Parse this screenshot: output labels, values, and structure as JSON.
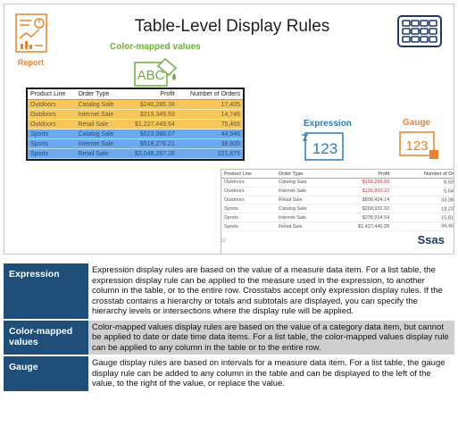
{
  "slide": {
    "title": "Table-Level Display Rules",
    "report_label": "Report",
    "color_mapped_label": "Color-mapped values",
    "abc_text": "ABC",
    "expression_label": "Expression",
    "expression_value": "123",
    "gauge_label": "Gauge",
    "gauge_value": "123",
    "brand": "Ssas"
  },
  "table1": {
    "headers": [
      "Product Line",
      "Order Type",
      "Profit",
      "Number of Orders"
    ],
    "rows": [
      [
        "Outdoors",
        "Catalog Sale",
        "$240,285.38",
        "17,405"
      ],
      [
        "Outdoors",
        "Internet Sale",
        "$219,349.93",
        "14,746"
      ],
      [
        "Outdoors",
        "Retail Sale",
        "$1,227,449.64",
        "75,465"
      ],
      [
        "Sports",
        "Catalog Sale",
        "$623,088.07",
        "44,946"
      ],
      [
        "Sports",
        "Internet Sale",
        "$518,276.21",
        "38,605"
      ],
      [
        "Sports",
        "Retail Sale",
        "$3,049,267.28",
        "221,875"
      ]
    ]
  },
  "table2": {
    "headers": [
      "Product Line",
      "Order Type",
      "Profit",
      "Number of Orders"
    ],
    "rows": [
      [
        "Outdoors",
        "Catalog Sale",
        "$158,255.69",
        "6,508"
      ],
      [
        "Outdoors",
        "Internet Sale",
        "$139,893.22",
        "5,643"
      ],
      [
        "Outdoors",
        "Retail Sale",
        "$808,424.14",
        "33,085"
      ],
      [
        "Sports",
        "Catalog Sale",
        "$269,932.92",
        "18,235"
      ],
      [
        "Sports",
        "Internet Sale",
        "$239,914.54",
        "15,810"
      ],
      [
        "Sports",
        "Retail Sale",
        "$1,427,440.28",
        "94,469"
      ]
    ],
    "gauge_colors": [
      "#e03a2a",
      "#e03a2a",
      "#6db33f",
      "#f0c43a",
      "#f0c43a",
      "#6db33f"
    ],
    "footer": "63"
  },
  "descriptions": [
    {
      "term": "Expression",
      "text": "Expression display rules are based on the value of a measure data item. For a list table, the expression display rule can be applied to the measure used in the expression, to another column in the table, or to the entire row. Crosstabs accept only expression display rules. If the crosstab contains a hierarchy or totals and subtotals are displayed, you can specify the hierarchy levels or intersections where the display rule will be applied."
    },
    {
      "term": "Color-mapped values",
      "text": "Color-mapped values display rules are based on the value of a category data item, but cannot be applied to date or date time data items. For a list table, the color-mapped values display rule can be applied to any column in the table or to the entire row."
    },
    {
      "term": "Gauge",
      "text": "Gauge display rules are based on intervals for a measure data item. For a list table, the gauge display rule can be added to any column in the table and can be displayed to the left of the value, to the right of the value, or replace the value."
    }
  ]
}
